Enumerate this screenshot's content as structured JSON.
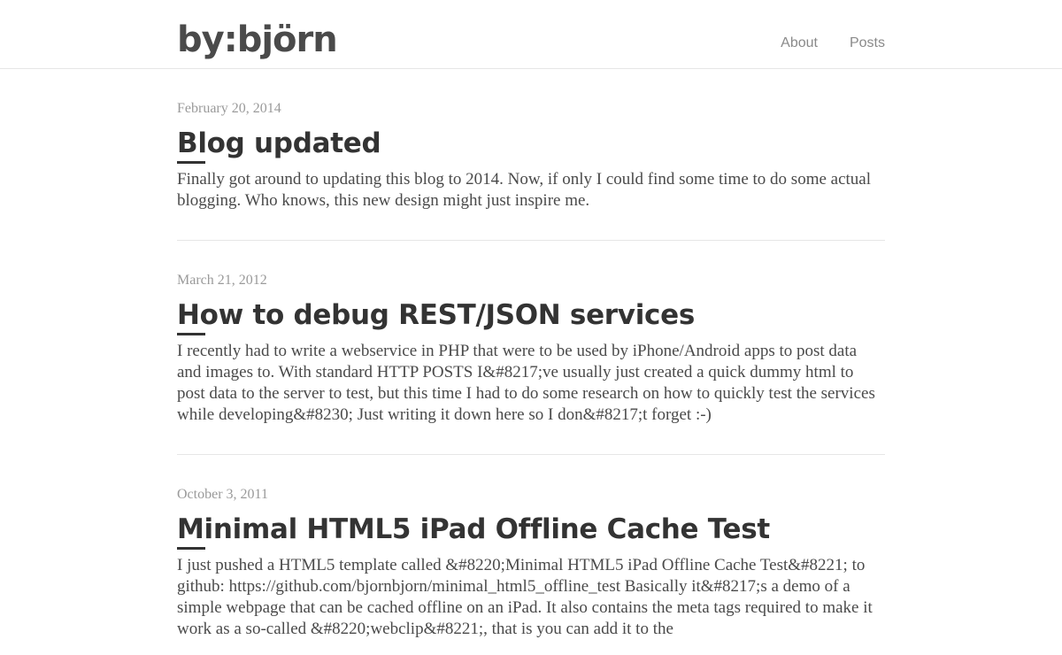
{
  "header": {
    "logo_text": "by:björn",
    "nav": [
      {
        "label": "About"
      },
      {
        "label": "Posts"
      }
    ]
  },
  "posts": [
    {
      "date": "February 20, 2014",
      "title": "Blog updated",
      "excerpt": "Finally got around to updating this blog to 2014. Now, if only I could find some time to do some actual blogging. Who knows, this new design might just inspire me."
    },
    {
      "date": "March 21, 2012",
      "title": "How to debug REST/JSON services",
      "excerpt": "I recently had to write a webservice in PHP that were to be used by iPhone/Android apps to post data and images to. With standard HTTP POSTS I&#8217;ve usually just created a quick dummy html to post data to the server to test, but this time I had to do some research on how to quickly test the services while developing&#8230; Just writing it down here so I don&#8217;t forget :-)"
    },
    {
      "date": "October 3, 2011",
      "title": "Minimal HTML5 iPad Offline Cache Test",
      "excerpt": "I just pushed a HTML5 template called &#8220;Minimal HTML5 iPad Offline Cache Test&#8221; to github: https://github.com/bjornbjorn/minimal_html5_offline_test Basically it&#8217;s a demo of a simple webpage that can be cached offline on an iPad. It also contains the meta tags required to make it work as a so-called &#8220;webclip&#8221;, that is you can add it to the"
    }
  ]
}
